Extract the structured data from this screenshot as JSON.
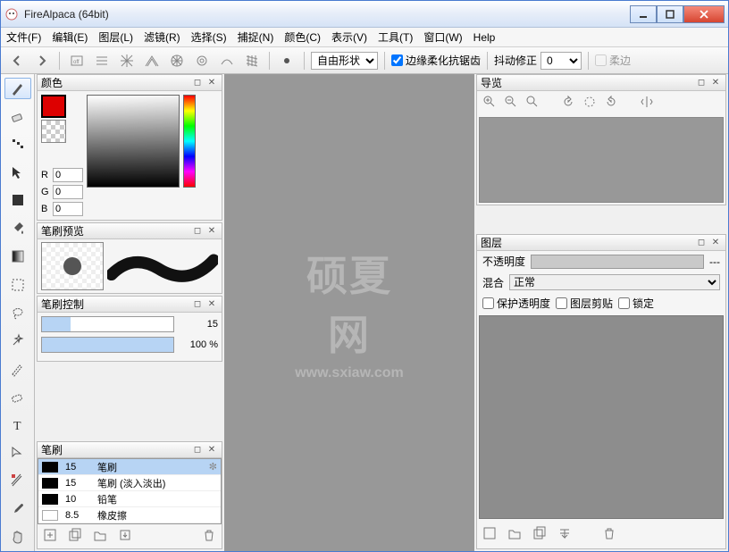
{
  "app": {
    "title": "FireAlpaca (64bit)"
  },
  "menu": {
    "file": "文件(F)",
    "edit": "编辑(E)",
    "layer": "图层(L)",
    "filter": "滤镜(R)",
    "select": "选择(S)",
    "capture": "捕捉(N)",
    "color": "颜色(C)",
    "view": "表示(V)",
    "tool": "工具(T)",
    "window": "窗口(W)",
    "help": "Help"
  },
  "toolbar": {
    "shape_select": "自由形状",
    "antialias_label": "边缘柔化抗锯齿",
    "jitter_label": "抖动修正",
    "jitter_val": "0",
    "soft_label": "柔边"
  },
  "panels": {
    "color": {
      "title": "颜色",
      "r_label": "R",
      "r_val": "0",
      "g_label": "G",
      "g_val": "0",
      "b_label": "B",
      "b_val": "0"
    },
    "brush_preview": {
      "title": "笔刷预览"
    },
    "brush_control": {
      "title": "笔刷控制",
      "size_val": "15",
      "opacity_val": "100 %"
    },
    "brush_list": {
      "title": "笔刷",
      "items": [
        {
          "size": "15",
          "name": "笔刷",
          "selected": true
        },
        {
          "size": "15",
          "name": "笔刷 (淡入淡出)"
        },
        {
          "size": "10",
          "name": "铅笔"
        },
        {
          "size": "8.5",
          "name": "橡皮擦",
          "blank": true
        }
      ]
    },
    "navigator": {
      "title": "导览"
    },
    "layers": {
      "title": "图层",
      "opacity_label": "不透明度",
      "opacity_dash": "---",
      "blend_label": "混合",
      "blend_mode": "正常",
      "protect_label": "保护透明度",
      "clip_label": "图层剪贴",
      "lock_label": "锁定"
    }
  },
  "watermark": {
    "big": "硕夏网",
    "small": "www.sxiaw.com"
  }
}
